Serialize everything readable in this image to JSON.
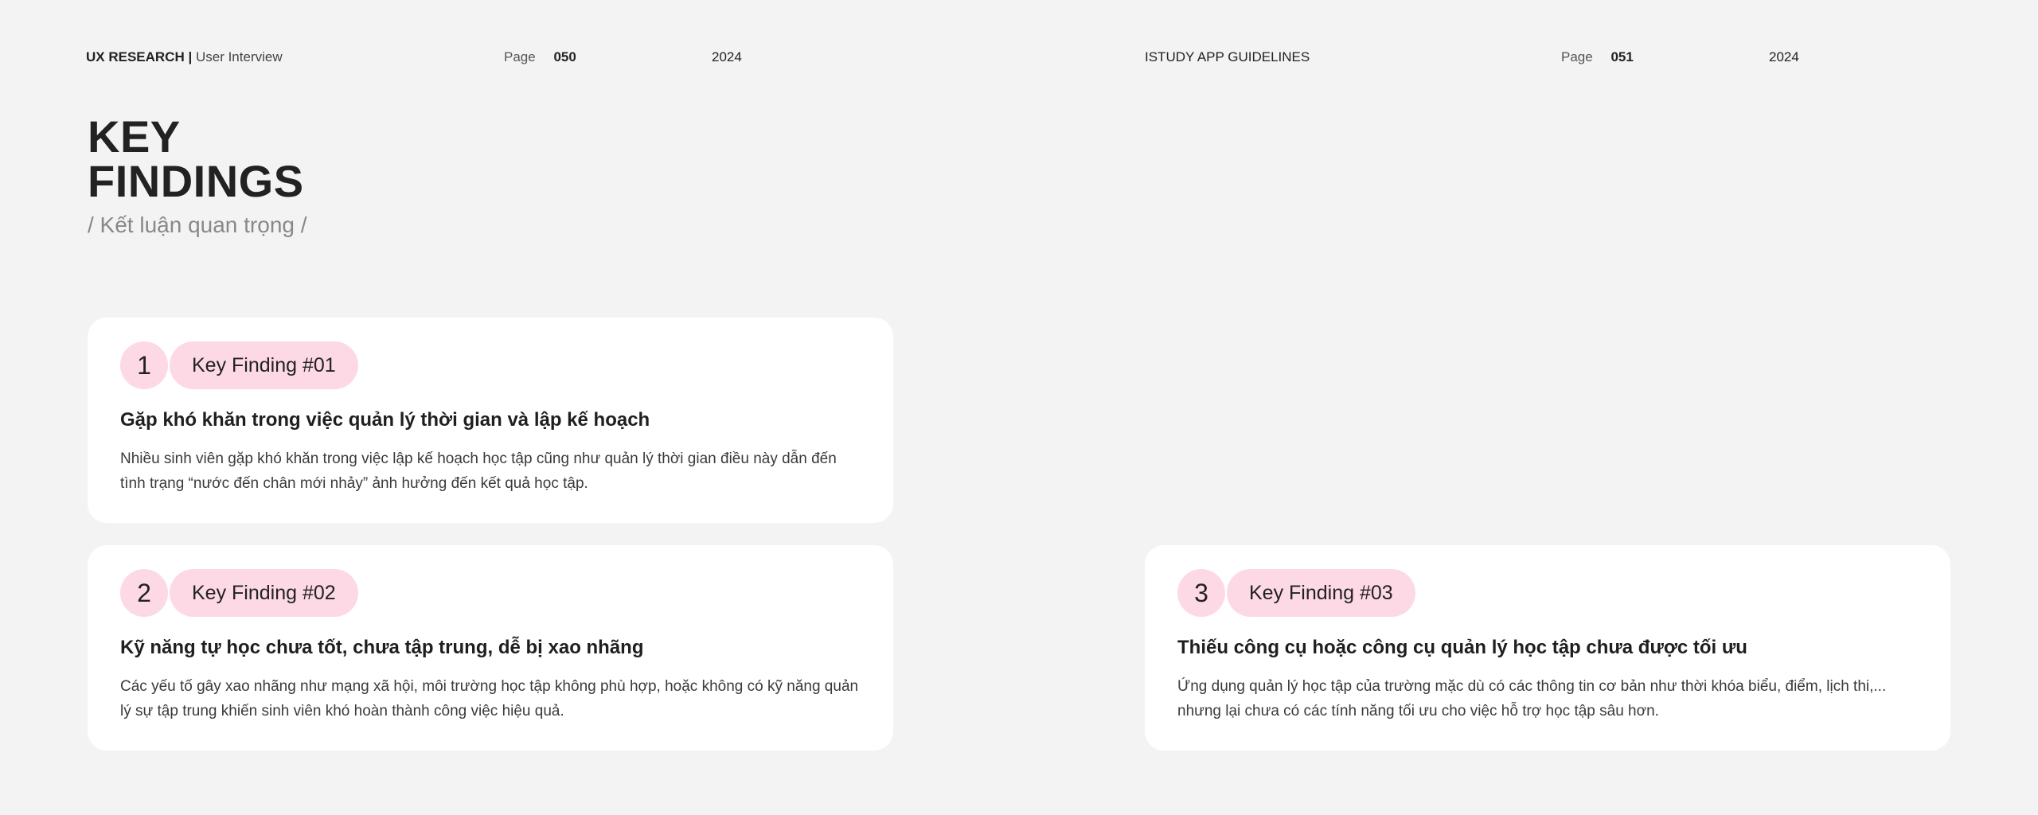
{
  "left_page": {
    "header": {
      "section": "UX RESEARCH |",
      "subsection": "User Interview",
      "page_label": "Page",
      "page_number": "050",
      "year": "2024"
    },
    "title_line1": "KEY",
    "title_line2": "FINDINGS",
    "subtitle": "/ Kết luận quan trọng /"
  },
  "right_page": {
    "header": {
      "section": "ISTUDY APP GUIDELINES",
      "page_label": "Page",
      "page_number": "051",
      "year": "2024"
    }
  },
  "findings": [
    {
      "number": "1",
      "label": "Key Finding #01",
      "heading": "Gặp khó khăn trong việc quản lý thời gian và lập kế hoạch",
      "body": "Nhiều sinh viên gặp khó khăn trong việc lập kế hoạch học tập cũng như quản lý thời gian điều này dẫn đến tình trạng “nước đến chân mới nhảy” ảnh hưởng đến kết quả học tập."
    },
    {
      "number": "2",
      "label": "Key Finding #02",
      "heading": "Kỹ năng tự học chưa tốt, chưa tập trung, dễ bị xao nhãng",
      "body": "Các yếu tố gây xao nhãng như mạng xã hội, môi trường học tập không phù hợp, hoặc không có kỹ năng quản lý sự tập trung khiến sinh viên khó hoàn thành công việc hiệu quả."
    },
    {
      "number": "3",
      "label": "Key Finding #03",
      "heading": "Thiếu công cụ hoặc công cụ quản lý học tập chưa được tối ưu",
      "body": "Ứng dụng quản lý học tập của trường mặc dù có các thông tin cơ bản như thời khóa biểu, điểm, lịch thi,... nhưng lại chưa có các tính năng tối ưu cho việc hỗ trợ học tập sâu hơn."
    }
  ],
  "colors": {
    "background": "#f3f3f3",
    "card": "#ffffff",
    "badge": "#fdd9e6",
    "text": "#1f1f1f",
    "muted": "#888888"
  }
}
